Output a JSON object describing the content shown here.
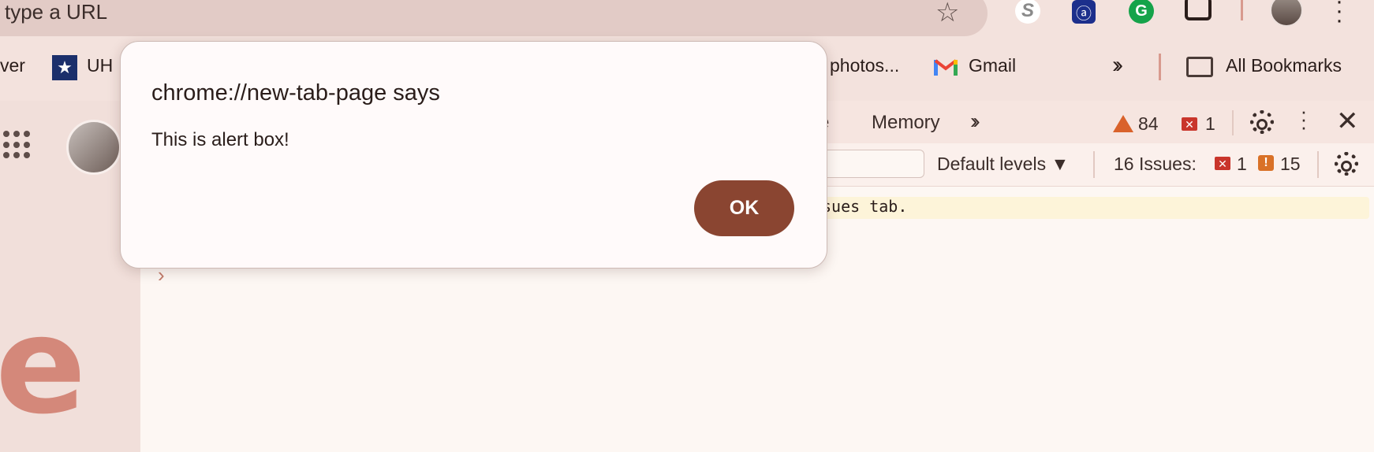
{
  "address_bar": {
    "text": "type a URL"
  },
  "bookmarks": {
    "partial_left": "ver",
    "uh": "UH",
    "photos": "photos...",
    "gmail": "Gmail",
    "all_bookmarks": "All Bookmarks"
  },
  "devtools": {
    "tabs": {
      "partial": "e",
      "memory": "Memory"
    },
    "warnings_count": "84",
    "errors_count": "1",
    "default_levels": "Default levels ▼",
    "issues_label": "16 Issues:",
    "issues_errors": "1",
    "issues_warnings": "15",
    "console_message_partial": "sues tab.",
    "prompt_symbol": "›"
  },
  "page": {
    "logo_letter": "e"
  },
  "dialog": {
    "title": "chrome://new-tab-page says",
    "message": "This is alert box!",
    "ok_label": "OK"
  },
  "colors": {
    "ok_button": "#8a4531",
    "error": "#c9352b",
    "warning": "#d97127",
    "logo": "#d4887a"
  }
}
